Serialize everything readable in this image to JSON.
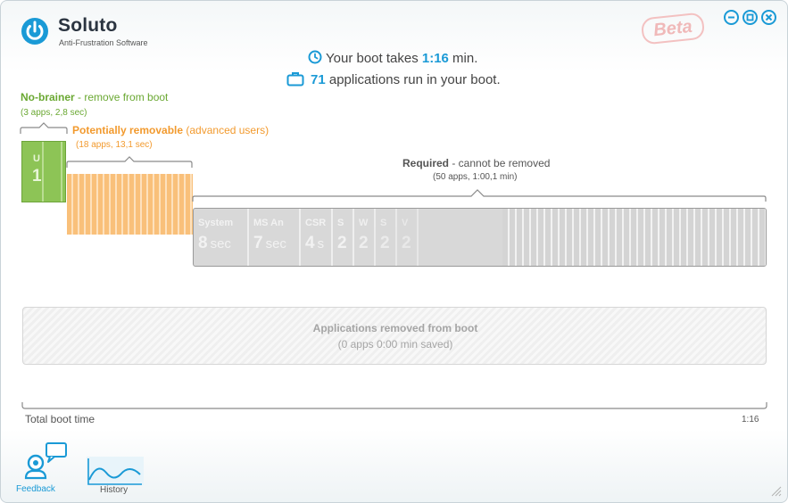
{
  "app": {
    "name": "Soluto",
    "tagline": "Anti-Frustration Software",
    "beta": "Beta"
  },
  "summary": {
    "boot_prefix": "Your boot takes ",
    "boot_time": "1:16",
    "boot_suffix": " min.",
    "apps_count": "71",
    "apps_suffix": " applications run in your boot."
  },
  "categories": {
    "no_brainer": {
      "title_bold": "No-brainer",
      "title_rest": " - remove from boot",
      "sub": "(3 apps, 2,8 sec)",
      "color": "#6aa832"
    },
    "potentially": {
      "title_bold": "Potentially removable",
      "title_rest": " (advanced users)",
      "sub": "(18 apps, 13,1 sec)",
      "color": "#f29a2e"
    },
    "required": {
      "title_bold": "Required",
      "title_rest": " - cannot be removed",
      "sub": "(50 apps, 1:00,1 min)",
      "color": "#555555"
    }
  },
  "green_block": {
    "name": "U",
    "time": "1"
  },
  "required_apps": [
    {
      "name": "System",
      "time": "8",
      "unit": "sec"
    },
    {
      "name": "MS An",
      "time": "7",
      "unit": "sec"
    },
    {
      "name": "CSR",
      "time": "4",
      "unit": "s"
    },
    {
      "name": "S",
      "time": "2",
      "unit": ""
    },
    {
      "name": "W",
      "time": "2",
      "unit": ""
    },
    {
      "name": "S",
      "time": "2",
      "unit": ""
    },
    {
      "name": "V",
      "time": "2",
      "unit": ""
    }
  ],
  "removed": {
    "title": "Applications removed from boot",
    "sub": "(0 apps 0:00 min saved)"
  },
  "total": {
    "label": "Total boot time",
    "value": "1:16"
  },
  "nav": {
    "feedback": "Feedback",
    "history": "History"
  },
  "colors": {
    "accent": "#1a9ad6",
    "green": "#8dc456",
    "orange": "#f9c07a",
    "gray": "#d8d8d8"
  }
}
